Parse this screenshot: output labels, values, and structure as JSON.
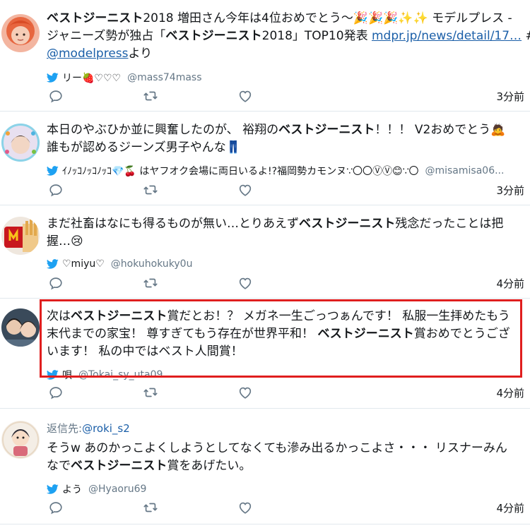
{
  "tweets": [
    {
      "segments": [
        {
          "text": "ベストジーニスト",
          "bold": true
        },
        {
          "text": "2018 増田さん今年は4位おめでとう〜🎉🎉🎉✨✨ モデルプレス -"
        }
      ],
      "segments2": [
        {
          "text": "ジャニーズ勢が独占「"
        },
        {
          "text": "ベストジーニスト",
          "bold": true
        },
        {
          "text": "2018」TOP10発表 "
        },
        {
          "text": "mdpr.jp/news/detail/17…",
          "link": true
        },
        {
          "text": " #"
        }
      ],
      "segments3": [
        {
          "text": "@modelpress",
          "link": true
        },
        {
          "text": "より"
        }
      ],
      "user": "リー🍓♡♡♡",
      "handle": "@mass74mass",
      "time": "3分前"
    },
    {
      "segments": [
        {
          "text": "本日のやぶひか並に興奮したのが、 裕翔の"
        },
        {
          "text": "ベストジーニスト",
          "bold": true
        },
        {
          "text": "！！！ V2おめでとう🙇"
        }
      ],
      "segments2": [
        {
          "text": "誰もが認めるジーンズ男子やんな👖"
        }
      ],
      "user": "ｲﾉｯｺﾉｯｺﾉｯｺ💎🍒 はヤフオク会場に両日いるよ!?福岡勢カモンヌ∵〇〇ⓋⓋ😊∵〇",
      "handle": "@misamisa06...",
      "time": "3分前"
    },
    {
      "segments": [
        {
          "text": "まだ社畜はなにも得るものが無い…とりあえず"
        },
        {
          "text": "ベストジーニスト",
          "bold": true
        },
        {
          "text": "残念だったことは把"
        }
      ],
      "segments2": [
        {
          "text": "握…😢"
        }
      ],
      "user": "♡miyu♡",
      "handle": "@hokuhokuky0u",
      "time": "4分前"
    },
    {
      "segments": [
        {
          "text": "次は"
        },
        {
          "text": "ベストジーニスト",
          "bold": true
        },
        {
          "text": "賞だとお！？ メガネ一生ごっつぁんです！ 私服一生拝めたもう"
        }
      ],
      "segments2": [
        {
          "text": "末代までの家宝！ 尊すぎてもう存在が世界平和！ "
        },
        {
          "text": "ベストジーニスト",
          "bold": true
        },
        {
          "text": "賞おめでとうござ"
        }
      ],
      "segments3": [
        {
          "text": "います！ 私の中ではベスト人間賞！"
        }
      ],
      "user": "唄",
      "handle": "@Tokai_sy_uta09",
      "time": "4分前"
    },
    {
      "reply_prefix": "返信先:",
      "reply_to": "@roki_s2",
      "segments": [
        {
          "text": "そうw あのかっこよくしようとしてなくても滲み出るかっこよさ・・・ リスナーみん"
        }
      ],
      "segments2": [
        {
          "text": "なで"
        },
        {
          "text": "ベストジーニスト",
          "bold": true
        },
        {
          "text": "賞をあげたい。"
        }
      ],
      "user": "よう",
      "handle": "@Hyaoru69",
      "time": "4分前"
    }
  ],
  "colors": {
    "highlight": "#e01e1e",
    "link": "#1b5fa8",
    "twitter_blue": "#1da1f2",
    "separator": "#e1e8ed"
  },
  "icons": [
    "twitter-bird-icon",
    "reply-icon",
    "retweet-icon",
    "like-icon"
  ]
}
